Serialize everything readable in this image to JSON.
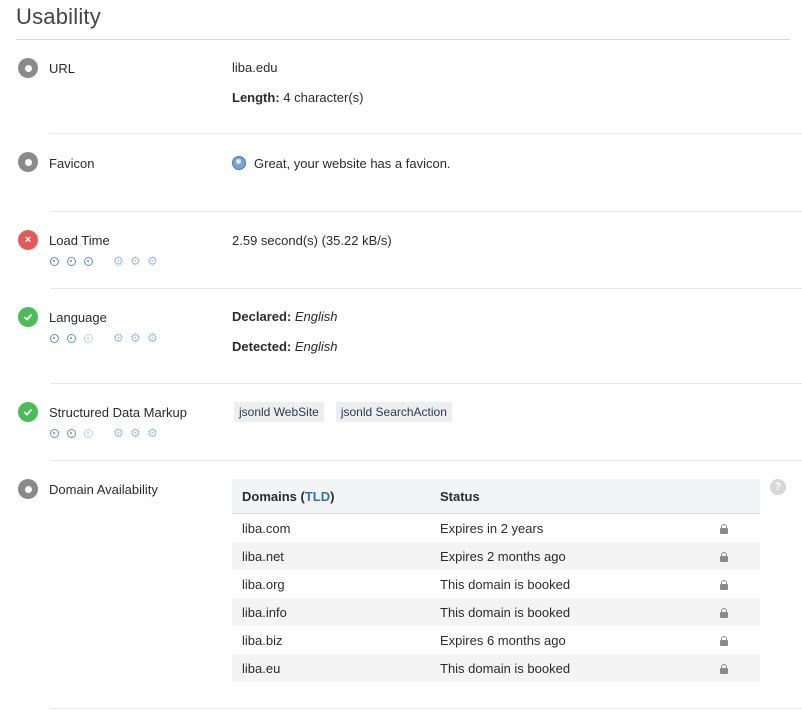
{
  "page_title": "Usability",
  "sections": {
    "url": {
      "label": "URL",
      "value": "liba.edu",
      "length_label": "Length:",
      "length_value": "4 character(s)",
      "status": "neutral",
      "icon": "eye-icon"
    },
    "favicon": {
      "label": "Favicon",
      "value": "Great, your website has a favicon.",
      "status": "neutral",
      "icon": "eye-icon",
      "favicon_icon": "globe-icon"
    },
    "load_time": {
      "label": "Load Time",
      "value": "2.59 second(s) (35.22 kB/s)",
      "status": "error",
      "icon": "error-x-icon",
      "status_glyph": "×",
      "meter": {
        "importance": 3,
        "importance_max": 3,
        "difficulty": 0,
        "difficulty_max": 3
      }
    },
    "language": {
      "label": "Language",
      "declared_label": "Declared:",
      "declared_value": "English",
      "detected_label": "Detected:",
      "detected_value": "English",
      "status": "ok",
      "icon": "check-icon",
      "meter": {
        "importance": 2,
        "importance_max": 3,
        "difficulty": 0,
        "difficulty_max": 3
      }
    },
    "structured_data": {
      "label": "Structured Data Markup",
      "tags": [
        "jsonld WebSite",
        "jsonld SearchAction"
      ],
      "status": "ok",
      "icon": "check-icon",
      "meter": {
        "importance": 2,
        "importance_max": 3,
        "difficulty": 0,
        "difficulty_max": 3
      }
    },
    "domain_availability": {
      "label": "Domain Availability",
      "status": "neutral",
      "icon": "eye-icon",
      "help_glyph": "?",
      "table": {
        "col_domains": "Domains",
        "col_tld": "TLD",
        "col_status": "Status",
        "rows": [
          {
            "domain": "liba.com",
            "status": "Expires in 2 years"
          },
          {
            "domain": "liba.net",
            "status": "Expires 2 months ago"
          },
          {
            "domain": "liba.org",
            "status": "This domain is booked"
          },
          {
            "domain": "liba.info",
            "status": "This domain is booked"
          },
          {
            "domain": "liba.biz",
            "status": "Expires 6 months ago"
          },
          {
            "domain": "liba.eu",
            "status": "This domain is booked"
          }
        ]
      }
    }
  },
  "colors": {
    "ok": "#4cbb5a",
    "error": "#e25b5b",
    "neutral": "#8a8a8a",
    "link": "#3b6fa8"
  }
}
